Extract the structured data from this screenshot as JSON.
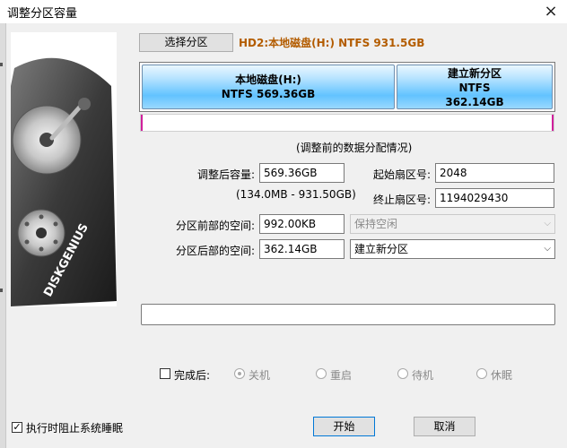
{
  "window": {
    "title": "调整分区容量",
    "close_icon": "×"
  },
  "toolbar": {
    "select_partition_label": "选择分区",
    "disk_info": "HD2:本地磁盘(H:) NTFS 931.5GB"
  },
  "partitions": [
    {
      "name": "本地磁盘(H:)",
      "fs": "NTFS",
      "size": "569.36GB"
    },
    {
      "name": "建立新分区",
      "fs": "NTFS",
      "size": "362.14GB"
    }
  ],
  "caption": "(调整前的数据分配情况)",
  "form": {
    "size_after_label": "调整后容量:",
    "size_after_value": "569.36GB",
    "size_range": "(134.0MB - 931.50GB)",
    "start_sector_label": "起始扇区号:",
    "start_sector_value": "2048",
    "end_sector_label": "终止扇区号:",
    "end_sector_value": "1194029430",
    "space_before_label": "分区前部的空间:",
    "space_before_value": "992.00KB",
    "space_before_action": "保持空闲",
    "space_after_label": "分区后部的空间:",
    "space_after_value": "362.14GB",
    "space_after_action": "建立新分区"
  },
  "after_done": {
    "label": "完成后:",
    "options": [
      "关机",
      "重启",
      "待机",
      "休眠"
    ]
  },
  "footer": {
    "prevent_sleep_label": "执行时阻止系统睡眠",
    "start_label": "开始",
    "cancel_label": "取消"
  },
  "brand": {
    "logo_text": "DISKGENIUS"
  },
  "colors": {
    "disk_info": "#b35c00",
    "partition_fill": "#62c3ff",
    "marker": "#d0209c",
    "focus_border": "#0078d7"
  }
}
